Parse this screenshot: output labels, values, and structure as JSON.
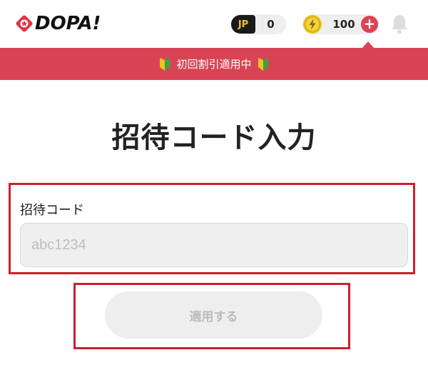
{
  "header": {
    "logo_text": "DOPA!",
    "jp_badge": "JP",
    "jp_count": "0",
    "coin_count": "100",
    "coin_plus": "+",
    "icons": [
      "dopa-logo-icon",
      "coin-icon",
      "plus-icon",
      "bell-icon",
      "beginner-mark-icon"
    ]
  },
  "banner": {
    "text": "初回割引適用中"
  },
  "page": {
    "title": "招待コード入力"
  },
  "form": {
    "label": "招待コード",
    "placeholder": "abc1234",
    "value": "",
    "submit_label": "適用する"
  },
  "colors": {
    "accent": "#d94455",
    "highlight_border": "#cc1f2c",
    "jp_gold": "#f2c230",
    "coin_gold": "#e8c01e",
    "disabled_bg": "#eeeeee",
    "disabled_text": "#bbbbbb"
  }
}
